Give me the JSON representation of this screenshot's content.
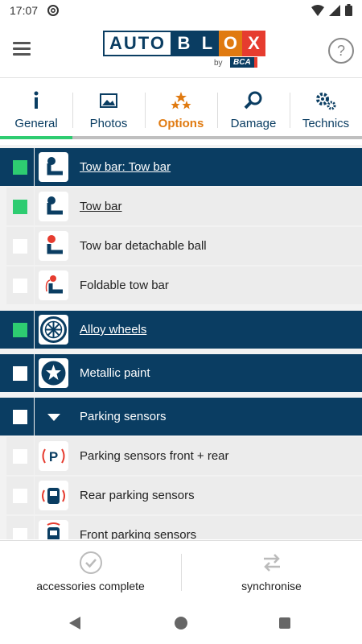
{
  "status": {
    "time": "17:07",
    "left_icon": "at-sign-icon",
    "wifi_icon": "wifi-icon",
    "signal_icon": "signal-icon",
    "battery_icon": "battery-icon"
  },
  "header": {
    "menu_icon": "hamburger-menu-icon",
    "logo": {
      "part1": "AUTO",
      "part2": [
        "B",
        "L",
        "O",
        "X"
      ],
      "part2_colors": [
        "#0a3d62",
        "#0a3d62",
        "#e07a10",
        "#e63c2f"
      ],
      "by": "by",
      "brand": "BCA"
    },
    "help_icon": "?"
  },
  "tabs": [
    {
      "label": "General",
      "icon": "info-icon"
    },
    {
      "label": "Photos",
      "icon": "image-icon"
    },
    {
      "label": "Options",
      "icon": "stars-icon",
      "active": true
    },
    {
      "label": "Damage",
      "icon": "magnifier-icon"
    },
    {
      "label": "Technics",
      "icon": "gears-icon"
    }
  ],
  "list": [
    {
      "label": "Tow bar: Tow bar",
      "type": "category",
      "checked": true,
      "icon": "tow-bar-icon",
      "link": true
    },
    {
      "label": "Tow bar",
      "type": "item",
      "checked": true,
      "icon": "tow-bar-icon",
      "link": true
    },
    {
      "label": "Tow bar detachable ball",
      "type": "item",
      "checked": false,
      "icon": "tow-bar-detachable-icon"
    },
    {
      "label": "Foldable tow bar",
      "type": "item",
      "checked": false,
      "icon": "tow-bar-foldable-icon"
    },
    {
      "label": "Alloy wheels",
      "type": "category",
      "checked": true,
      "icon": "alloy-wheel-icon",
      "link": true
    },
    {
      "label": "Metallic paint",
      "type": "category",
      "checked": false,
      "icon": "metallic-paint-icon"
    },
    {
      "label": "Parking sensors",
      "type": "category",
      "checked": false,
      "icon": "chevron-down-icon"
    },
    {
      "label": "Parking sensors front + rear",
      "type": "item",
      "checked": false,
      "icon": "parking-sensor-icon"
    },
    {
      "label": "Rear parking sensors",
      "type": "item",
      "checked": false,
      "icon": "rear-parking-sensor-icon"
    },
    {
      "label": "Front parking sensors",
      "type": "item",
      "checked": false,
      "icon": "front-parking-sensor-icon"
    }
  ],
  "actions": {
    "complete_label": "accessories complete",
    "complete_icon": "check-circle-icon",
    "sync_label": "synchronise",
    "sync_icon": "sync-arrows-icon"
  },
  "colors": {
    "navy": "#0a3d62",
    "orange": "#e07a10",
    "green": "#2ecc71",
    "red": "#e63c2f"
  }
}
